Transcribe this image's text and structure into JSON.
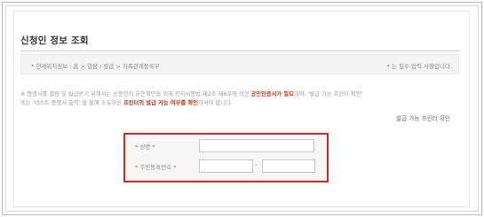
{
  "page": {
    "title": "신청인 정보 조회",
    "breadcrumb": "* 현재위치정보 : 홈 > 열람 / 발급 > 가족관계등록부",
    "required_prefix": "*",
    "required_text": " 는 필수 입력 사항입니다."
  },
  "notice": {
    "line1_a": "※ 증명서를 열람 및 발급받기 위해서는 신청인의 본인확인을 위해 전자서명법 제2조 제8호에 의한 ",
    "line1_hl1": "공인인증서가 필요",
    "line1_b": "하며, '발급 가능 프린터 확인'",
    "line2_a": "또는 '테스트 증명서 출력' 을 통해 소유하신 ",
    "line2_hl": "프린터의 발급 가능 여부를 확인",
    "line2_b": "하셔야 합니다."
  },
  "links": {
    "printer_check": "발급 가능 프린터 확인"
  },
  "form": {
    "name_label": "성명",
    "rrn_label": "주민등록번호",
    "label_mark": "*",
    "name_value": "",
    "rrn_front_value": "",
    "rrn_back_value": "",
    "separator": "-"
  },
  "colors": {
    "highlight_border": "#d9261c",
    "required_mark": "#d45b3a"
  }
}
